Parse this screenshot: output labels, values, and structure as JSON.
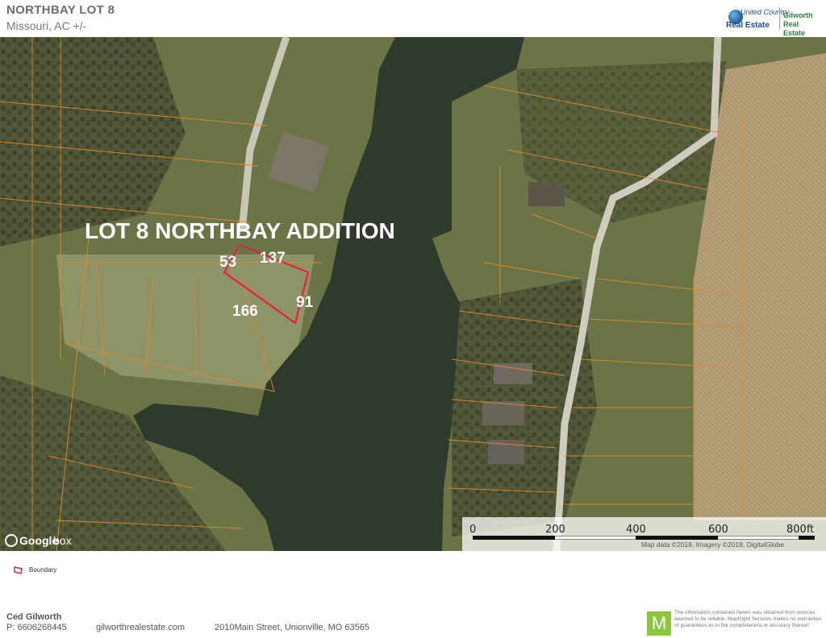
{
  "header": {
    "title": "NORTHBAY LOT 8",
    "subtitle": "Missouri,  AC +/-"
  },
  "brand": {
    "united_country": "United Country",
    "real_estate": "Real Estate",
    "gilworth_line1": "Gilworth",
    "gilworth_line2": "Real Estate"
  },
  "map": {
    "headline": "LOT 8 NORTHBAY ADDITION",
    "dimensions": {
      "top_left": "53",
      "top": "137",
      "right": "91",
      "bottom": "166"
    },
    "scale_labels": [
      "0",
      "200",
      "400",
      "600",
      "800ft"
    ],
    "attribution": "Map data ©2018, Imagery ©2018, DigitalGlobe",
    "provider": "Google",
    "provider_suffix": "box",
    "colors": {
      "boundary": "#e8223a",
      "parcel_lines": "#e08a2e",
      "water": "#2f3b2c",
      "field": "#b39a74"
    }
  },
  "legend": {
    "boundary_label": "Boundary"
  },
  "footer": {
    "name": "Ced Gilworth",
    "phone": "P: 6606268445",
    "website": "gilworthrealestate.com",
    "address": "2010Main Street, Unionville, MO  63565"
  },
  "disclaimer": {
    "logo_letter": "M",
    "text": "The information contained herein was obtained from sources deemed to be reliable. MapRight Services makes no warranties or guarantees as to the completeness or accuracy thereof."
  }
}
